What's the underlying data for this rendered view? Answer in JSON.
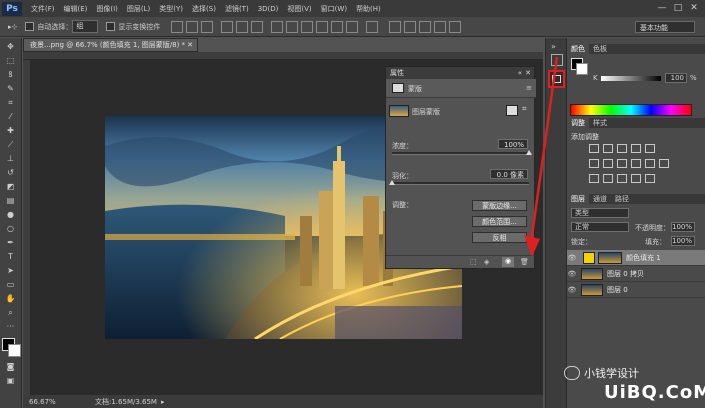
{
  "app": {
    "logo": "Ps",
    "menu": [
      "文件(F)",
      "编辑(E)",
      "图像(I)",
      "图层(L)",
      "类型(Y)",
      "选择(S)",
      "滤镜(T)",
      "3D(D)",
      "视图(V)",
      "窗口(W)",
      "帮助(H)"
    ],
    "window_controls": [
      "—",
      "□",
      "✕"
    ]
  },
  "options_bar": {
    "tool_glyph": "▸⊹",
    "auto_select_label": "自动选择：",
    "auto_select_value": "组",
    "show_transform_label": "显示变换控件",
    "workspace": "基本功能"
  },
  "document": {
    "tab_title": "夜景...png @ 66.7% (颜色填充 1, 图层蒙版/8) *",
    "tab_close": "✕",
    "zoom": "66.67%",
    "doc_size": "文档:1.65M/3.65M"
  },
  "properties": {
    "title": "属性",
    "section": "蒙版",
    "mask_type": "图层蒙版",
    "density_label": "浓度：",
    "density_value": "100%",
    "density_fraction": 1.0,
    "feather_label": "羽化：",
    "feather_value": "0.0 像素",
    "feather_fraction": 0.0,
    "refine_label": "调整：",
    "btn_edge": "蒙版边缘...",
    "btn_color_range": "颜色范围...",
    "btn_invert": "反相"
  },
  "color_panel": {
    "tabs": [
      "颜色",
      "色板"
    ],
    "channel_label": "K",
    "channel_value": "100",
    "percent": "%"
  },
  "adjust_panel": {
    "tabs": [
      "调整",
      "样式"
    ],
    "title": "添加调整"
  },
  "layers_panel": {
    "tabs": [
      "图层",
      "通道",
      "路径"
    ],
    "filter_kind": "类型",
    "blend_mode": "正常",
    "opacity_label": "不透明度：",
    "opacity_value": "100%",
    "lock_label": "锁定：",
    "fill_label": "填充：",
    "fill_value": "100%",
    "layers": [
      {
        "name": "颜色填充 1",
        "type": "fill",
        "selected": true
      },
      {
        "name": "图层 0 拷贝",
        "type": "image",
        "selected": false
      },
      {
        "name": "图层 0",
        "type": "image",
        "selected": false
      }
    ]
  },
  "watermark": {
    "brand": "小钱学设计",
    "site": "UiBQ.CoM"
  },
  "colors": {
    "highlight": "#e02020",
    "accent": "#f2d400",
    "selected_row": "#7a7a7a"
  }
}
